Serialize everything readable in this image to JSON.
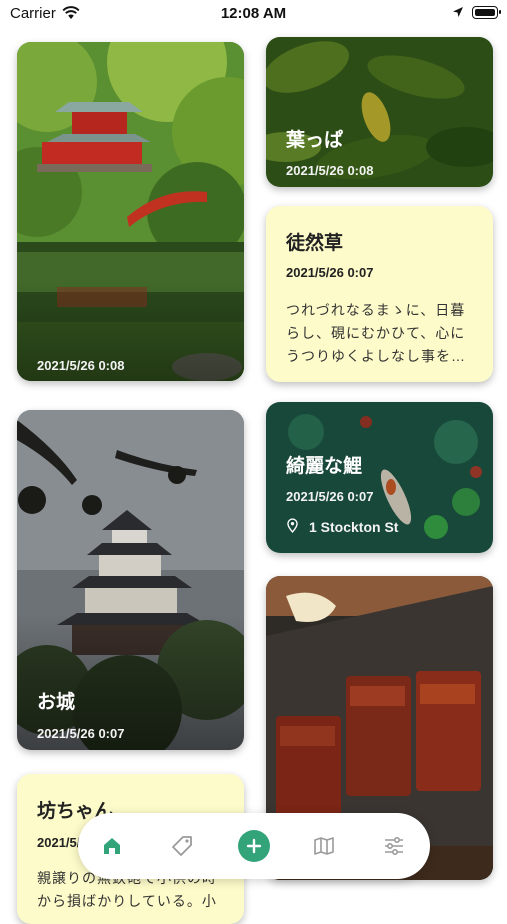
{
  "status_bar": {
    "carrier": "Carrier",
    "time": "12:08 AM"
  },
  "cards": [
    {
      "kind": "photo",
      "scene": "red-pagoda-garden-pond",
      "date": "2021/5/26 0:08"
    },
    {
      "kind": "photo",
      "scene": "green-leaves",
      "title": "葉っぱ",
      "date": "2021/5/26 0:08"
    },
    {
      "kind": "note",
      "title": "徒然草",
      "date": "2021/5/26 0:07",
      "body_lines": [
        "つれづれなるまゝに、日暮",
        "らし、硯にむかひて、心に",
        "うつりゆくよしなし事を…"
      ]
    },
    {
      "kind": "photo",
      "scene": "koi-pond",
      "title": "綺麗な鯉",
      "date": "2021/5/26 0:07",
      "location_icon": "pin-icon",
      "location": "1 Stockton St"
    },
    {
      "kind": "photo",
      "scene": "japanese-castle",
      "title": "お城",
      "date": "2021/5/26 0:07"
    },
    {
      "kind": "photo",
      "scene": "grilled-eel"
    },
    {
      "kind": "note",
      "title": "坊ちゃん",
      "date": "2021/5/26 0:0",
      "body_lines": [
        "親譲りの無鉄砲で小供の時",
        "から損ばかりしている。小"
      ]
    }
  ],
  "nav": {
    "items": [
      {
        "name": "home",
        "icon": "home-icon",
        "active": true
      },
      {
        "name": "tags",
        "icon": "tag-icon"
      },
      {
        "name": "add",
        "icon": "plus-icon"
      },
      {
        "name": "map",
        "icon": "map-icon"
      },
      {
        "name": "filters",
        "icon": "sliders-icon"
      }
    ]
  },
  "colors": {
    "accent": "#33a37a",
    "note_background": "#fdfbc9",
    "icon_gray": "#9a9a9a"
  }
}
